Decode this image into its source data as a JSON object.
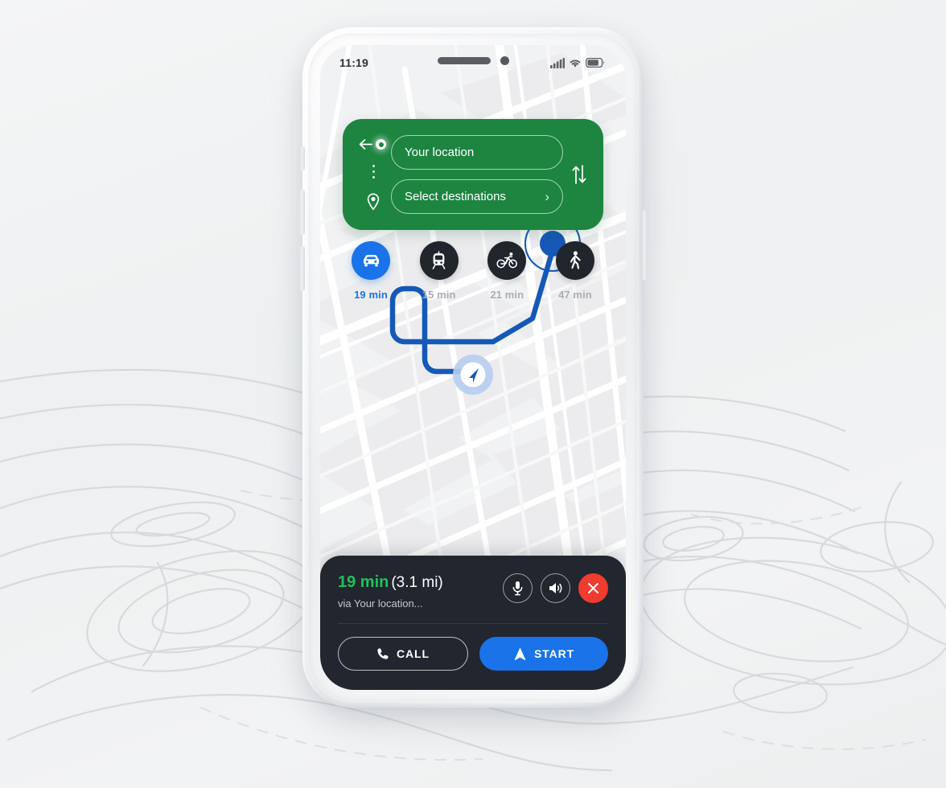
{
  "status_bar": {
    "time": "11:19",
    "signal_icon": "cellular-signal-icon",
    "wifi_icon": "wifi-icon",
    "battery_icon": "battery-icon"
  },
  "search_panel": {
    "back_icon": "back-arrow-icon",
    "origin_icon": "origin-dot-icon",
    "destination_icon": "map-pin-icon",
    "swap_icon": "swap-vertical-icon",
    "origin_value": "Your location",
    "origin_placeholder": "Your location",
    "destination_value": "Select destinations",
    "destination_placeholder": "Select destinations",
    "destination_chevron": "›",
    "background_color": "#1d8540"
  },
  "transport_modes": [
    {
      "id": "drive",
      "icon": "car-icon",
      "time": "19 min",
      "active": true
    },
    {
      "id": "transit",
      "icon": "tram-icon",
      "time": "15 min",
      "active": false
    },
    {
      "id": "bike",
      "icon": "bicycle-icon",
      "time": "21 min",
      "active": false
    },
    {
      "id": "walk",
      "icon": "walking-icon",
      "time": "47 min",
      "active": false
    }
  ],
  "map": {
    "route_color": "#1559b8",
    "destination_marker_icon": "destination-pin-icon",
    "current_location_icon": "navigation-arrow-icon"
  },
  "nav_card": {
    "eta_time": "19 min",
    "eta_distance": "(3.1 mi)",
    "via_text": "via Your location...",
    "mic_icon": "microphone-icon",
    "volume_icon": "volume-icon",
    "close_icon": "close-x-icon",
    "call_label": "CALL",
    "call_icon": "phone-icon",
    "start_label": "START",
    "start_icon": "navigation-arrow-icon",
    "accent_color": "#1a73e8",
    "eta_color": "#1fc25a",
    "close_color": "#ef3b30",
    "background_color": "#22262e"
  }
}
